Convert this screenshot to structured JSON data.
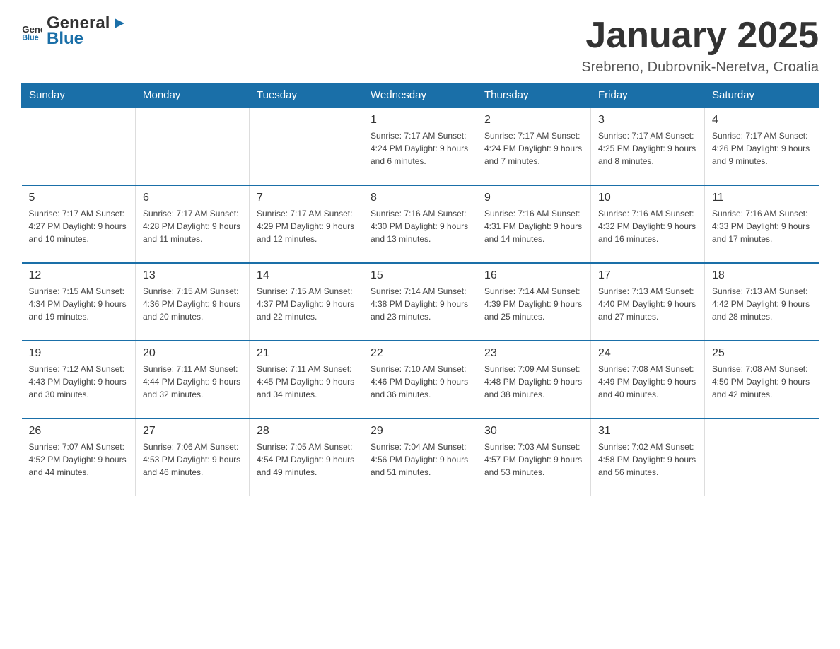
{
  "header": {
    "logo_general": "General",
    "logo_blue": "Blue",
    "title": "January 2025",
    "subtitle": "Srebreno, Dubrovnik-Neretva, Croatia"
  },
  "days_of_week": [
    "Sunday",
    "Monday",
    "Tuesday",
    "Wednesday",
    "Thursday",
    "Friday",
    "Saturday"
  ],
  "weeks": [
    [
      {
        "day": "",
        "info": ""
      },
      {
        "day": "",
        "info": ""
      },
      {
        "day": "",
        "info": ""
      },
      {
        "day": "1",
        "info": "Sunrise: 7:17 AM\nSunset: 4:24 PM\nDaylight: 9 hours and 6 minutes."
      },
      {
        "day": "2",
        "info": "Sunrise: 7:17 AM\nSunset: 4:24 PM\nDaylight: 9 hours and 7 minutes."
      },
      {
        "day": "3",
        "info": "Sunrise: 7:17 AM\nSunset: 4:25 PM\nDaylight: 9 hours and 8 minutes."
      },
      {
        "day": "4",
        "info": "Sunrise: 7:17 AM\nSunset: 4:26 PM\nDaylight: 9 hours and 9 minutes."
      }
    ],
    [
      {
        "day": "5",
        "info": "Sunrise: 7:17 AM\nSunset: 4:27 PM\nDaylight: 9 hours and 10 minutes."
      },
      {
        "day": "6",
        "info": "Sunrise: 7:17 AM\nSunset: 4:28 PM\nDaylight: 9 hours and 11 minutes."
      },
      {
        "day": "7",
        "info": "Sunrise: 7:17 AM\nSunset: 4:29 PM\nDaylight: 9 hours and 12 minutes."
      },
      {
        "day": "8",
        "info": "Sunrise: 7:16 AM\nSunset: 4:30 PM\nDaylight: 9 hours and 13 minutes."
      },
      {
        "day": "9",
        "info": "Sunrise: 7:16 AM\nSunset: 4:31 PM\nDaylight: 9 hours and 14 minutes."
      },
      {
        "day": "10",
        "info": "Sunrise: 7:16 AM\nSunset: 4:32 PM\nDaylight: 9 hours and 16 minutes."
      },
      {
        "day": "11",
        "info": "Sunrise: 7:16 AM\nSunset: 4:33 PM\nDaylight: 9 hours and 17 minutes."
      }
    ],
    [
      {
        "day": "12",
        "info": "Sunrise: 7:15 AM\nSunset: 4:34 PM\nDaylight: 9 hours and 19 minutes."
      },
      {
        "day": "13",
        "info": "Sunrise: 7:15 AM\nSunset: 4:36 PM\nDaylight: 9 hours and 20 minutes."
      },
      {
        "day": "14",
        "info": "Sunrise: 7:15 AM\nSunset: 4:37 PM\nDaylight: 9 hours and 22 minutes."
      },
      {
        "day": "15",
        "info": "Sunrise: 7:14 AM\nSunset: 4:38 PM\nDaylight: 9 hours and 23 minutes."
      },
      {
        "day": "16",
        "info": "Sunrise: 7:14 AM\nSunset: 4:39 PM\nDaylight: 9 hours and 25 minutes."
      },
      {
        "day": "17",
        "info": "Sunrise: 7:13 AM\nSunset: 4:40 PM\nDaylight: 9 hours and 27 minutes."
      },
      {
        "day": "18",
        "info": "Sunrise: 7:13 AM\nSunset: 4:42 PM\nDaylight: 9 hours and 28 minutes."
      }
    ],
    [
      {
        "day": "19",
        "info": "Sunrise: 7:12 AM\nSunset: 4:43 PM\nDaylight: 9 hours and 30 minutes."
      },
      {
        "day": "20",
        "info": "Sunrise: 7:11 AM\nSunset: 4:44 PM\nDaylight: 9 hours and 32 minutes."
      },
      {
        "day": "21",
        "info": "Sunrise: 7:11 AM\nSunset: 4:45 PM\nDaylight: 9 hours and 34 minutes."
      },
      {
        "day": "22",
        "info": "Sunrise: 7:10 AM\nSunset: 4:46 PM\nDaylight: 9 hours and 36 minutes."
      },
      {
        "day": "23",
        "info": "Sunrise: 7:09 AM\nSunset: 4:48 PM\nDaylight: 9 hours and 38 minutes."
      },
      {
        "day": "24",
        "info": "Sunrise: 7:08 AM\nSunset: 4:49 PM\nDaylight: 9 hours and 40 minutes."
      },
      {
        "day": "25",
        "info": "Sunrise: 7:08 AM\nSunset: 4:50 PM\nDaylight: 9 hours and 42 minutes."
      }
    ],
    [
      {
        "day": "26",
        "info": "Sunrise: 7:07 AM\nSunset: 4:52 PM\nDaylight: 9 hours and 44 minutes."
      },
      {
        "day": "27",
        "info": "Sunrise: 7:06 AM\nSunset: 4:53 PM\nDaylight: 9 hours and 46 minutes."
      },
      {
        "day": "28",
        "info": "Sunrise: 7:05 AM\nSunset: 4:54 PM\nDaylight: 9 hours and 49 minutes."
      },
      {
        "day": "29",
        "info": "Sunrise: 7:04 AM\nSunset: 4:56 PM\nDaylight: 9 hours and 51 minutes."
      },
      {
        "day": "30",
        "info": "Sunrise: 7:03 AM\nSunset: 4:57 PM\nDaylight: 9 hours and 53 minutes."
      },
      {
        "day": "31",
        "info": "Sunrise: 7:02 AM\nSunset: 4:58 PM\nDaylight: 9 hours and 56 minutes."
      },
      {
        "day": "",
        "info": ""
      }
    ]
  ]
}
